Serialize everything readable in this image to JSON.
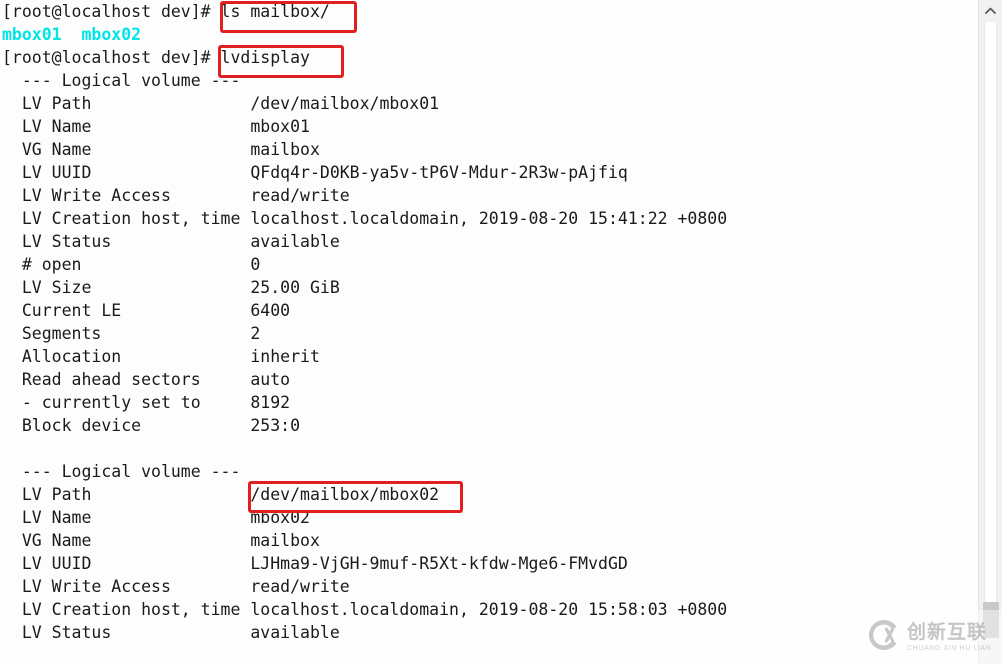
{
  "terminal": {
    "prompt": "[root@localhost dev]# ",
    "lines": [
      {
        "type": "prompt",
        "prompt": "[root@localhost dev]# ",
        "command": "ls mailbox/"
      },
      {
        "type": "cyan",
        "text": "mbox01  mbox02"
      },
      {
        "type": "prompt",
        "prompt": "[root@localhost dev]# ",
        "command": "lvdisplay"
      },
      {
        "type": "plain",
        "text": "  --- Logical volume ---"
      },
      {
        "type": "plain",
        "text": "  LV Path                /dev/mailbox/mbox01"
      },
      {
        "type": "plain",
        "text": "  LV Name                mbox01"
      },
      {
        "type": "plain",
        "text": "  VG Name                mailbox"
      },
      {
        "type": "plain",
        "text": "  LV UUID                QFdq4r-D0KB-ya5v-tP6V-Mdur-2R3w-pAjfiq"
      },
      {
        "type": "plain",
        "text": "  LV Write Access        read/write"
      },
      {
        "type": "plain",
        "text": "  LV Creation host, time localhost.localdomain, 2019-08-20 15:41:22 +0800"
      },
      {
        "type": "plain",
        "text": "  LV Status              available"
      },
      {
        "type": "plain",
        "text": "  # open                 0"
      },
      {
        "type": "plain",
        "text": "  LV Size                25.00 GiB"
      },
      {
        "type": "plain",
        "text": "  Current LE             6400"
      },
      {
        "type": "plain",
        "text": "  Segments               2"
      },
      {
        "type": "plain",
        "text": "  Allocation             inherit"
      },
      {
        "type": "plain",
        "text": "  Read ahead sectors     auto"
      },
      {
        "type": "plain",
        "text": "  - currently set to     8192"
      },
      {
        "type": "plain",
        "text": "  Block device           253:0"
      },
      {
        "type": "blank",
        "text": " "
      },
      {
        "type": "plain",
        "text": "  --- Logical volume ---"
      },
      {
        "type": "plain",
        "text": "  LV Path                /dev/mailbox/mbox02"
      },
      {
        "type": "plain",
        "text": "  LV Name                mbox02"
      },
      {
        "type": "plain",
        "text": "  VG Name                mailbox"
      },
      {
        "type": "plain",
        "text": "  LV UUID                LJHma9-VjGH-9muf-R5Xt-kfdw-Mge6-FMvdGD"
      },
      {
        "type": "plain",
        "text": "  LV Write Access        read/write"
      },
      {
        "type": "plain",
        "text": "  LV Creation host, time localhost.localdomain, 2019-08-20 15:58:03 +0800"
      },
      {
        "type": "plain",
        "text": "  LV Status              available"
      }
    ]
  },
  "annotations": {
    "color": "#e02020",
    "boxes": [
      {
        "label": "ls mailbox/"
      },
      {
        "label": "lvdisplay"
      },
      {
        "label": "/dev/mailbox/mbox02"
      }
    ]
  },
  "scrollbar": {
    "up_arrow_icon": "chevron-up-icon"
  },
  "watermark": {
    "logo_icon": "cx-circle-logo-icon",
    "cn_text": "创新互联",
    "en_text": "CHUANG XIN HU LIAN"
  },
  "colors": {
    "background": "#fdfdfd",
    "text": "#1a1a1a",
    "cyan": "#00e5e5",
    "annotation_red": "#e02020",
    "scrollbar_track": "#f1f1f1",
    "scrollbar_thumb": "#c9c9c9"
  }
}
